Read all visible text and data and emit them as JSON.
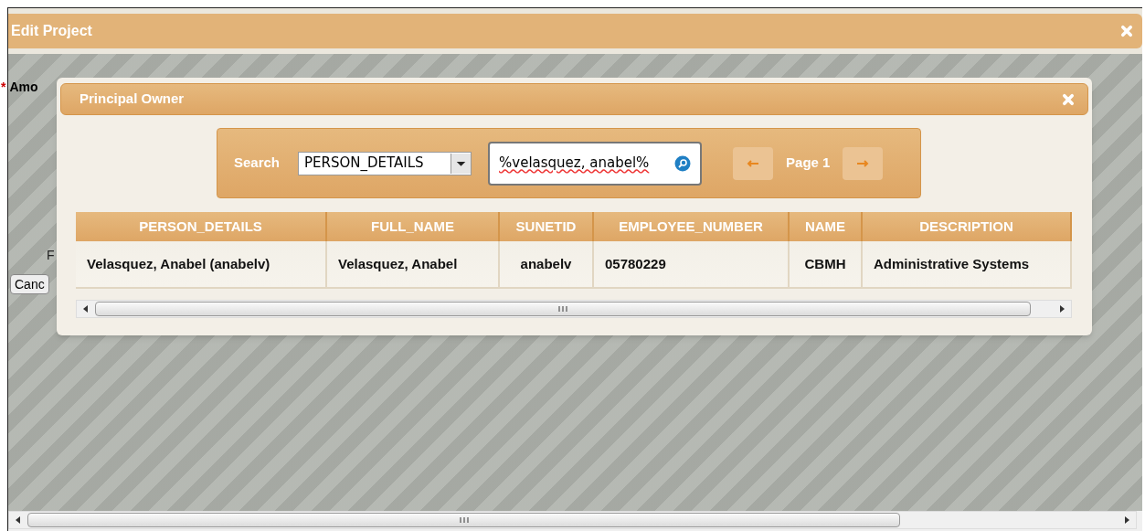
{
  "window": {
    "title": "Edit Project"
  },
  "background_form": {
    "fields": [
      {
        "required_mark": "*",
        "label": "Amo"
      },
      {
        "label": "F"
      }
    ],
    "button": "Canc"
  },
  "dialog": {
    "title": "Principal Owner",
    "search": {
      "label": "Search",
      "column": "PERSON_DETAILS",
      "query": "%velasquez, anabel%",
      "page": "Page 1"
    },
    "table": {
      "columns": [
        "PERSON_DETAILS",
        "FULL_NAME",
        "SUNETID",
        "EMPLOYEE_NUMBER",
        "NAME",
        "DESCRIPTION"
      ],
      "rows": [
        [
          "Velasquez, Anabel (anabelv)",
          "Velasquez, Anabel",
          "anabelv",
          "05780229",
          "CBMH",
          "Administrative Systems"
        ]
      ]
    }
  }
}
